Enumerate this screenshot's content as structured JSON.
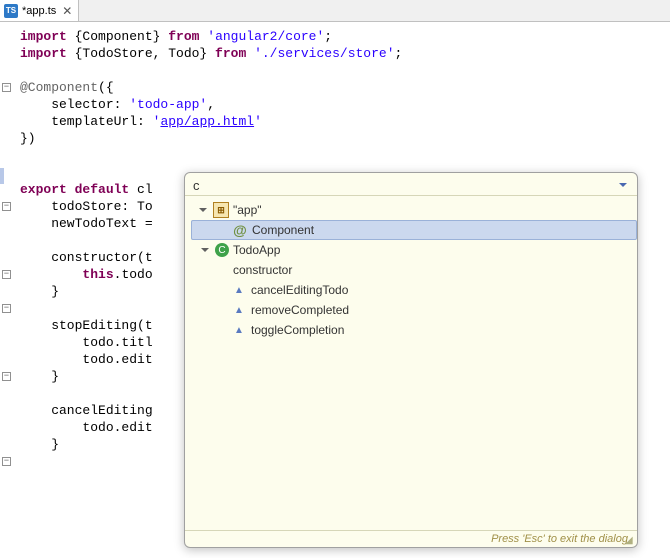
{
  "tab": {
    "title": "*app.ts"
  },
  "code": {
    "l1a": "import",
    "l1b": " {Component} ",
    "l1c": "from",
    "l1d": " ",
    "l1e": "'angular2/core'",
    "l1f": ";",
    "l2a": "import",
    "l2b": " {TodoStore, Todo} ",
    "l2c": "from",
    "l2d": " ",
    "l2e": "'./services/store'",
    "l2f": ";",
    "l4a": "@Component",
    "l4b": "({",
    "l5a": "    selector: ",
    "l5b": "'todo-app'",
    "l5c": ",",
    "l6a": "    templateUrl: ",
    "l6b": "'",
    "l6c": "app/app.html",
    "l6d": "'",
    "l7": "})",
    "l9a": "export",
    "l9b": " ",
    "l9c": "default",
    "l9d": " cl",
    "l10": "    todoStore: To",
    "l11": "    newTodoText =",
    "l13": "    constructor(t",
    "l14a": "        ",
    "l14b": "this",
    "l14c": ".todo",
    "l15": "    }",
    "l17": "    stopEditing(t",
    "l18": "        todo.titl",
    "l19": "        todo.edit",
    "l20": "    }",
    "l22": "    cancelEditing",
    "l23": "        todo.edit",
    "l24": "    }"
  },
  "popup": {
    "filter": "c",
    "footer": "Press 'Esc' to exit the dialog.",
    "tree": {
      "app": {
        "label": "\"app\""
      },
      "component": {
        "label": "Component"
      },
      "todoApp": {
        "label": "TodoApp"
      },
      "constructor": {
        "label": "constructor"
      },
      "cancelEditingTodo": {
        "label": "cancelEditingTodo"
      },
      "removeCompleted": {
        "label": "removeCompleted"
      },
      "toggleCompletion": {
        "label": "toggleCompletion"
      }
    }
  }
}
